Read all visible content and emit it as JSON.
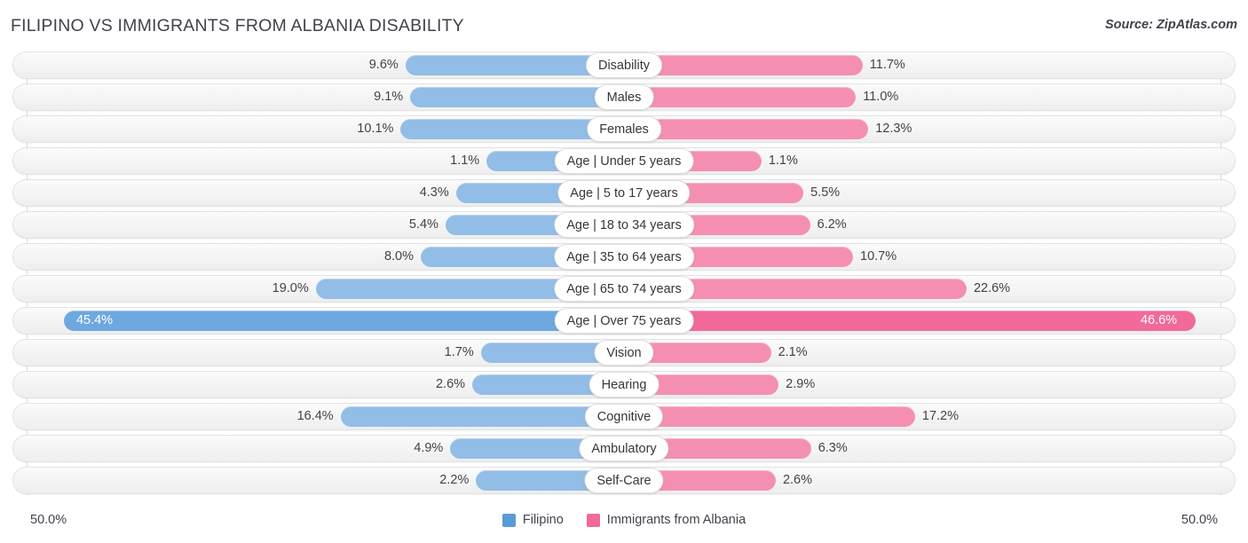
{
  "header": {
    "title": "FILIPINO VS IMMIGRANTS FROM ALBANIA DISABILITY",
    "source": "Source: ZipAtlas.com"
  },
  "footer": {
    "axis_min": "50.0%",
    "axis_max": "50.0%",
    "legend": [
      {
        "label": "Filipino",
        "color": "#5b9bd5"
      },
      {
        "label": "Immigrants from Albania",
        "color": "#f2699b"
      }
    ]
  },
  "colors": {
    "left_bar": "#92bde6",
    "right_bar": "#f48fb3",
    "left_bar_highlight": "#6da8e0",
    "right_bar_highlight": "#f2699b",
    "track": "#f4f4f4",
    "text": "#42424c"
  },
  "chart_data": {
    "type": "bar",
    "orientation": "horizontal-diverging",
    "title": "FILIPINO VS IMMIGRANTS FROM ALBANIA DISABILITY",
    "xlabel": "",
    "ylabel": "",
    "xlim": [
      50.0,
      50.0
    ],
    "grid": true,
    "legend_position": "bottom-center",
    "series": [
      {
        "name": "Filipino",
        "side": "left",
        "color": "#92bde6",
        "values": [
          9.6,
          9.1,
          10.1,
          1.1,
          4.3,
          5.4,
          8.0,
          19.0,
          45.4,
          1.7,
          2.6,
          16.4,
          4.9,
          2.2
        ]
      },
      {
        "name": "Immigrants from Albania",
        "side": "right",
        "color": "#f48fb3",
        "values": [
          11.7,
          11.0,
          12.3,
          1.1,
          5.5,
          6.2,
          10.7,
          22.6,
          46.6,
          2.1,
          2.9,
          17.2,
          6.3,
          2.6
        ]
      }
    ],
    "categories": [
      "Disability",
      "Males",
      "Females",
      "Age | Under 5 years",
      "Age | 5 to 17 years",
      "Age | 18 to 34 years",
      "Age | 35 to 64 years",
      "Age | 65 to 74 years",
      "Age | Over 75 years",
      "Vision",
      "Hearing",
      "Cognitive",
      "Ambulatory",
      "Self-Care"
    ],
    "rows": [
      {
        "label": "Disability",
        "left_value": 9.6,
        "right_value": 11.7,
        "left_label": "9.6%",
        "right_label": "11.7%",
        "highlight": false
      },
      {
        "label": "Males",
        "left_value": 9.1,
        "right_value": 11.0,
        "left_label": "9.1%",
        "right_label": "11.0%",
        "highlight": false
      },
      {
        "label": "Females",
        "left_value": 10.1,
        "right_value": 12.3,
        "left_label": "10.1%",
        "right_label": "12.3%",
        "highlight": false
      },
      {
        "label": "Age | Under 5 years",
        "left_value": 1.1,
        "right_value": 1.1,
        "left_label": "1.1%",
        "right_label": "1.1%",
        "highlight": false
      },
      {
        "label": "Age | 5 to 17 years",
        "left_value": 4.3,
        "right_value": 5.5,
        "left_label": "4.3%",
        "right_label": "5.5%",
        "highlight": false
      },
      {
        "label": "Age | 18 to 34 years",
        "left_value": 5.4,
        "right_value": 6.2,
        "left_label": "5.4%",
        "right_label": "6.2%",
        "highlight": false
      },
      {
        "label": "Age | 35 to 64 years",
        "left_value": 8.0,
        "right_value": 10.7,
        "left_label": "8.0%",
        "right_label": "10.7%",
        "highlight": false
      },
      {
        "label": "Age | 65 to 74 years",
        "left_value": 19.0,
        "right_value": 22.6,
        "left_label": "19.0%",
        "right_label": "22.6%",
        "highlight": false
      },
      {
        "label": "Age | Over 75 years",
        "left_value": 45.4,
        "right_value": 46.6,
        "left_label": "45.4%",
        "right_label": "46.6%",
        "highlight": true
      },
      {
        "label": "Vision",
        "left_value": 1.7,
        "right_value": 2.1,
        "left_label": "1.7%",
        "right_label": "2.1%",
        "highlight": false
      },
      {
        "label": "Hearing",
        "left_value": 2.6,
        "right_value": 2.9,
        "left_label": "2.6%",
        "right_label": "2.9%",
        "highlight": false
      },
      {
        "label": "Cognitive",
        "left_value": 16.4,
        "right_value": 17.2,
        "left_label": "16.4%",
        "right_label": "17.2%",
        "highlight": false
      },
      {
        "label": "Ambulatory",
        "left_value": 4.9,
        "right_value": 6.3,
        "left_label": "4.9%",
        "right_label": "6.3%",
        "highlight": false
      },
      {
        "label": "Self-Care",
        "left_value": 2.2,
        "right_value": 2.6,
        "left_label": "2.2%",
        "right_label": "2.6%",
        "highlight": false
      }
    ]
  }
}
